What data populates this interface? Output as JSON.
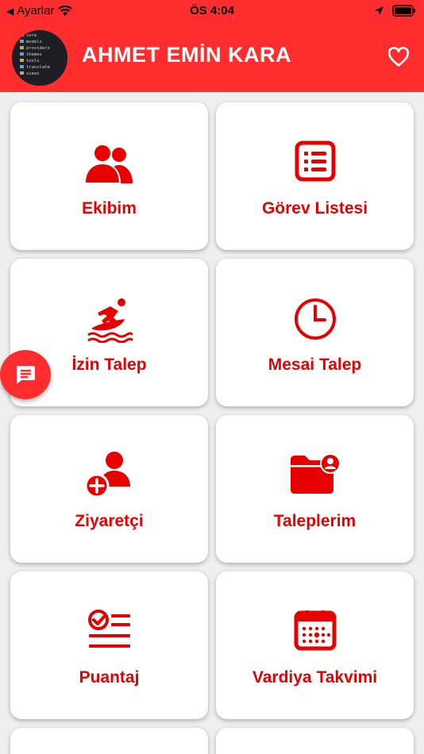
{
  "status_bar": {
    "back_app": "Ayarlar",
    "time": "ÖS 4:04"
  },
  "header": {
    "user_name": "AHMET EMİN KARA"
  },
  "avatar_lines": [
    "core",
    "models",
    "providers",
    "themes",
    "tools",
    "translate",
    "views"
  ],
  "menu": {
    "team": "Ekibim",
    "task_list": "Görev Listesi",
    "leave_request": "İzin Talep",
    "overtime_request": "Mesai Talep",
    "visitor": "Ziyaretçi",
    "my_requests": "Taleplerim",
    "timesheet": "Puantaj",
    "shift_calendar": "Vardiya Takvimi"
  },
  "colors": {
    "brand": "#ff2d2d",
    "accent_text": "#e60000",
    "background": "#efefef"
  },
  "icons": [
    "team-icon",
    "task-list-icon",
    "surfing-icon",
    "clock-icon",
    "add-person-icon",
    "folder-user-icon",
    "checklist-icon",
    "calendar-icon",
    "chat-icon",
    "heart-icon"
  ]
}
